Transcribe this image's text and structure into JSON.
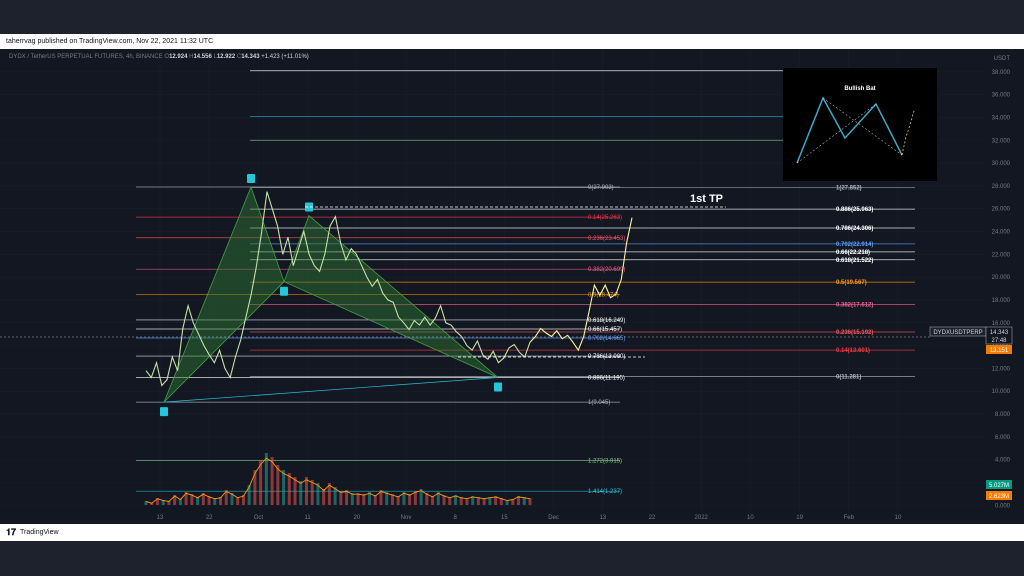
{
  "header": {
    "publisher": "taherrvag published on TradingView.com, Nov 22, 2021 11:32 UTC"
  },
  "footer": {
    "logo": "𝟏𝟕",
    "brand": "TradingView"
  },
  "ohlc": {
    "symbol": "DYDX / TetherUS PERPETUAL FUTURES, 4h, BINANCE",
    "o_label": "O",
    "o": "12.924",
    "h_label": "H",
    "h": "14.556",
    "l_label": "L",
    "l": "12.922",
    "c_label": "C",
    "c": "14.343",
    "change": "+1.423 (+11.01%)"
  },
  "chart_data": {
    "type": "line",
    "symbol": "DYDXUSDTPERP",
    "currency": "USDT",
    "annotation": "1st TP",
    "pattern_label": "Bullish Bat",
    "price_axis": {
      "ticks": [
        "38.000",
        "36.000",
        "34.000",
        "32.000",
        "30.000",
        "28.000",
        "26.000",
        "24.000",
        "22.000",
        "20.000",
        "18.000",
        "16.000",
        "14.000",
        "12.000",
        "10.000",
        "8.000",
        "6.000",
        "4.000",
        "2.000",
        "0.000"
      ],
      "ylim": [
        -0.5,
        40
      ]
    },
    "time_axis": {
      "ticks": [
        "13",
        "22",
        "Oct",
        "11",
        "20",
        "Nov",
        "8",
        "15",
        "Dec",
        "13",
        "22",
        "2022",
        "10",
        "19",
        "Feb",
        "10"
      ]
    },
    "labels": {
      "symbol_tag": "DYDXUSDTPERP",
      "last_price": "14.343",
      "countdown": "27:48",
      "level_tag": "13.151",
      "vol1": "5.027M",
      "vol2": "2.623M"
    },
    "fib_retracement_left": [
      {
        "ratio": "0",
        "price": 27.903,
        "color": "#b2b5be"
      },
      {
        "ratio": "0.14",
        "price": 25.263,
        "color": "#f23645"
      },
      {
        "ratio": "0.236",
        "price": 23.453,
        "color": "#f7525f"
      },
      {
        "ratio": "0.382",
        "price": 20.699,
        "color": "#f06292"
      },
      {
        "ratio": "0.5",
        "price": 18.474,
        "color": "#ff9800"
      },
      {
        "ratio": "0.618",
        "price": 16.249,
        "color": "#ffffff"
      },
      {
        "ratio": "0.66",
        "price": 15.457,
        "color": "#ffffff"
      },
      {
        "ratio": "0.702",
        "price": 14.665,
        "color": "#5b9cf6"
      },
      {
        "ratio": "0.786",
        "price": 13.08,
        "color": "#ffffff"
      },
      {
        "ratio": "0.886",
        "price": 11.195,
        "color": "#ffffff"
      },
      {
        "ratio": "1",
        "price": 9.045,
        "color": "#b2b5be"
      },
      {
        "ratio": "1.272",
        "price": 3.915,
        "color": "#81c784"
      },
      {
        "ratio": "1.414",
        "price": 1.237,
        "color": "#26c6da"
      }
    ],
    "fib_retracement_right": [
      {
        "ratio": "1.618",
        "price": 38.093,
        "color": "#ffffff"
      },
      {
        "ratio": "1.414",
        "price": 34.1,
        "color": "#26c6da"
      },
      {
        "ratio": "1.27",
        "price": 32.0,
        "color": "#81c784"
      },
      {
        "ratio": "1",
        "price": 27.852,
        "color": "#b2b5be"
      },
      {
        "ratio": "0.886",
        "price": 25.963,
        "color": "#ffffff"
      },
      {
        "ratio": "0.786",
        "price": 24.306,
        "color": "#ffffff"
      },
      {
        "ratio": "0.702",
        "price": 22.914,
        "color": "#5b9cf6"
      },
      {
        "ratio": "0.66",
        "price": 22.218,
        "color": "#ffffff"
      },
      {
        "ratio": "0.618",
        "price": 21.522,
        "color": "#ffffff"
      },
      {
        "ratio": "0.5",
        "price": 19.567,
        "color": "#ff9800"
      },
      {
        "ratio": "0.382",
        "price": 17.612,
        "color": "#f06292"
      },
      {
        "ratio": "0.236",
        "price": 15.192,
        "color": "#f7525f"
      },
      {
        "ratio": "0.14",
        "price": 13.601,
        "color": "#f23645"
      },
      {
        "ratio": "0",
        "price": 11.281,
        "color": "#b2b5be"
      }
    ],
    "harmonic_points": [
      {
        "name": "X",
        "price": 9.045
      },
      {
        "name": "A",
        "price": 27.903
      },
      {
        "name": "B",
        "price": 19.6
      },
      {
        "name": "C",
        "price": 25.4
      },
      {
        "name": "D",
        "price": 11.2
      }
    ],
    "price_path": [
      11.8,
      11.2,
      12.5,
      10.5,
      11.0,
      13.0,
      11.8,
      15.5,
      17.5,
      16.0,
      15.0,
      14.0,
      13.2,
      12.5,
      13.6,
      12.0,
      11.2,
      13.0,
      14.5,
      16.5,
      18.5,
      21.0,
      24.0,
      27.5,
      26.0,
      24.5,
      22.0,
      23.5,
      21.0,
      22.5,
      24.0,
      22.0,
      21.0,
      20.5,
      22.0,
      24.5,
      25.3,
      23.0,
      21.5,
      22.5,
      22.0,
      21.0,
      20.0,
      19.2,
      19.8,
      18.6,
      18.0,
      17.8,
      16.5,
      16.0,
      15.4,
      16.2,
      15.8,
      16.5,
      15.8,
      16.4,
      17.5,
      16.0,
      15.8,
      15.2,
      14.8,
      14.0,
      13.6,
      14.4,
      13.2,
      12.8,
      13.5,
      12.5,
      12.9,
      13.8,
      14.1,
      13.4,
      13.0,
      14.3
    ],
    "projection_path": [
      14.3,
      14.8,
      15.5,
      15.1,
      14.8,
      15.3,
      14.6,
      14.9,
      14.3,
      13.6,
      14.8,
      17.0,
      19.3,
      18.4,
      19.3,
      18.2,
      18.5,
      19.8,
      23.0,
      25.2
    ],
    "volume_path": [
      0.4,
      0.2,
      0.7,
      0.5,
      0.4,
      1.0,
      0.6,
      1.3,
      1.1,
      0.8,
      1.2,
      0.9,
      0.7,
      0.8,
      1.5,
      1.2,
      0.8,
      1.0,
      2.0,
      3.5,
      4.5,
      5.2,
      4.8,
      4.0,
      3.5,
      3.2,
      2.8,
      2.4,
      2.8,
      2.5,
      2.2,
      1.6,
      2.2,
      1.8,
      1.4,
      1.5,
      1.2,
      1.2,
      1.1,
      1.3,
      1.0,
      1.5,
      1.3,
      1.1,
      0.9,
      1.3,
      1.1,
      1.4,
      1.6,
      1.2,
      0.9,
      1.3,
      1.0,
      0.8,
      1.0,
      0.8,
      0.7,
      0.9,
      0.8,
      0.7,
      0.8,
      0.9,
      0.7,
      0.5,
      0.6,
      0.9,
      0.8,
      0.7
    ]
  }
}
